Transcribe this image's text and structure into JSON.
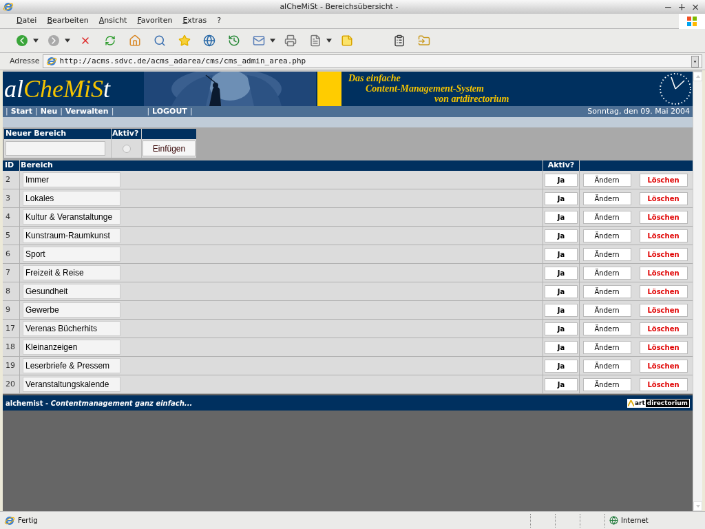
{
  "window": {
    "title": "alCheMiSt - Bereichsübersicht -",
    "controls": [
      "−",
      "+",
      "×"
    ]
  },
  "menu": [
    {
      "label": "Datei"
    },
    {
      "label": "Bearbeiten"
    },
    {
      "label": "Ansicht"
    },
    {
      "label": "Favoriten"
    },
    {
      "label": "Extras"
    },
    {
      "label": "?"
    }
  ],
  "address": {
    "label": "Adresse",
    "url": "http://acms.sdvc.de/acms_adarea/cms/cms_admin_area.php"
  },
  "header": {
    "logo": [
      {
        "text": "al",
        "accent": false
      },
      {
        "text": "Che",
        "accent": true
      },
      {
        "text": "Mi",
        "accent": true
      },
      {
        "text": "S",
        "accent": true
      },
      {
        "text": "t",
        "accent": false
      }
    ],
    "tagline": [
      "Das einfache",
      "Content-Management-System",
      "von artdirectorium"
    ],
    "nav": [
      {
        "kind": "separator",
        "text": "|"
      },
      {
        "kind": "link",
        "text": "Start"
      },
      {
        "kind": "separator",
        "text": "|"
      },
      {
        "kind": "link",
        "text": "Neu"
      },
      {
        "kind": "separator",
        "text": "|"
      },
      {
        "kind": "link",
        "text": "Verwalten"
      },
      {
        "kind": "separator",
        "text": "|"
      },
      {
        "kind": "spacer"
      },
      {
        "kind": "separator",
        "text": "|"
      },
      {
        "kind": "link",
        "text": "LOGOUT"
      },
      {
        "kind": "separator",
        "text": "|"
      }
    ],
    "date": "Sonntag, den 09. Mai 2004"
  },
  "new_area": {
    "label": "Neuer Bereich",
    "active_label": "Aktiv?",
    "active": false,
    "button": "Einfügen"
  },
  "table": {
    "columns": [
      "ID",
      "Bereich",
      "Aktiv?"
    ],
    "rows": [
      {
        "id": "2",
        "name": "Immer",
        "active": "Ja",
        "edit": "Ändern",
        "delete": "Löschen"
      },
      {
        "id": "3",
        "name": "Lokales",
        "active": "Ja",
        "edit": "Ändern",
        "delete": "Löschen"
      },
      {
        "id": "4",
        "name": "Kultur & Veranstaltunge",
        "active": "Ja",
        "edit": "Ändern",
        "delete": "Löschen"
      },
      {
        "id": "5",
        "name": "Kunstraum-Raumkunst",
        "active": "Ja",
        "edit": "Ändern",
        "delete": "Löschen"
      },
      {
        "id": "6",
        "name": "Sport",
        "active": "Ja",
        "edit": "Ändern",
        "delete": "Löschen"
      },
      {
        "id": "7",
        "name": "Freizeit & Reise",
        "active": "Ja",
        "edit": "Ändern",
        "delete": "Löschen"
      },
      {
        "id": "8",
        "name": "Gesundheit",
        "active": "Ja",
        "edit": "Ändern",
        "delete": "Löschen"
      },
      {
        "id": "9",
        "name": "Gewerbe",
        "active": "Ja",
        "edit": "Ändern",
        "delete": "Löschen"
      },
      {
        "id": "17",
        "name": "Verenas Bücherhits",
        "active": "Ja",
        "edit": "Ändern",
        "delete": "Löschen"
      },
      {
        "id": "18",
        "name": "Kleinanzeigen",
        "active": "Ja",
        "edit": "Ändern",
        "delete": "Löschen"
      },
      {
        "id": "19",
        "name": "Leserbriefe & Pressem",
        "active": "Ja",
        "edit": "Ändern",
        "delete": "Löschen"
      },
      {
        "id": "20",
        "name": "Veranstaltungskalende",
        "active": "Ja",
        "edit": "Ändern",
        "delete": "Löschen"
      }
    ]
  },
  "footer": {
    "brand": "alchemist",
    "separator": " - ",
    "slogan": "Contentmanagement ganz einfach...",
    "badge_a": "art",
    "badge_b": "directorium"
  },
  "status_bar": {
    "text": "Fertig",
    "zone": "Internet"
  }
}
